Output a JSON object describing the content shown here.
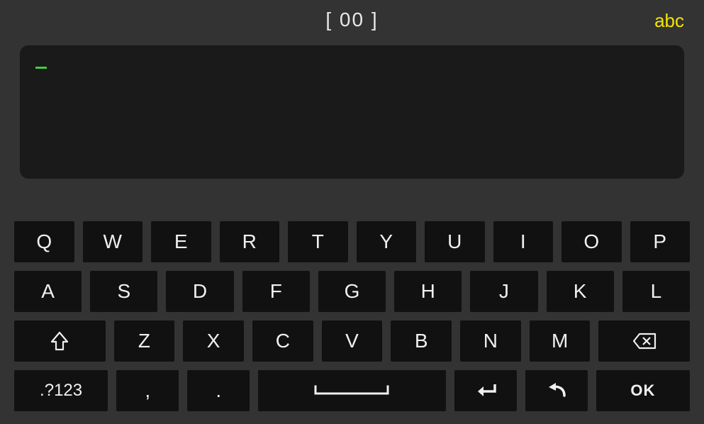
{
  "header": {
    "counter": "[ 00 ]",
    "mode_label": "abc"
  },
  "input": {
    "value": ""
  },
  "rows": {
    "r1": [
      "Q",
      "W",
      "E",
      "R",
      "T",
      "Y",
      "U",
      "I",
      "O",
      "P"
    ],
    "r2": [
      "A",
      "S",
      "D",
      "F",
      "G",
      "H",
      "J",
      "K",
      "L"
    ],
    "r3": [
      "Z",
      "X",
      "C",
      "V",
      "B",
      "N",
      "M"
    ]
  },
  "special": {
    "symbols": ".?123",
    "comma": ",",
    "period": ".",
    "ok": "OK"
  },
  "icons": {
    "shift": "shift-icon",
    "backspace": "backspace-icon",
    "space": "space-icon",
    "enter": "enter-icon",
    "undo": "undo-icon"
  }
}
